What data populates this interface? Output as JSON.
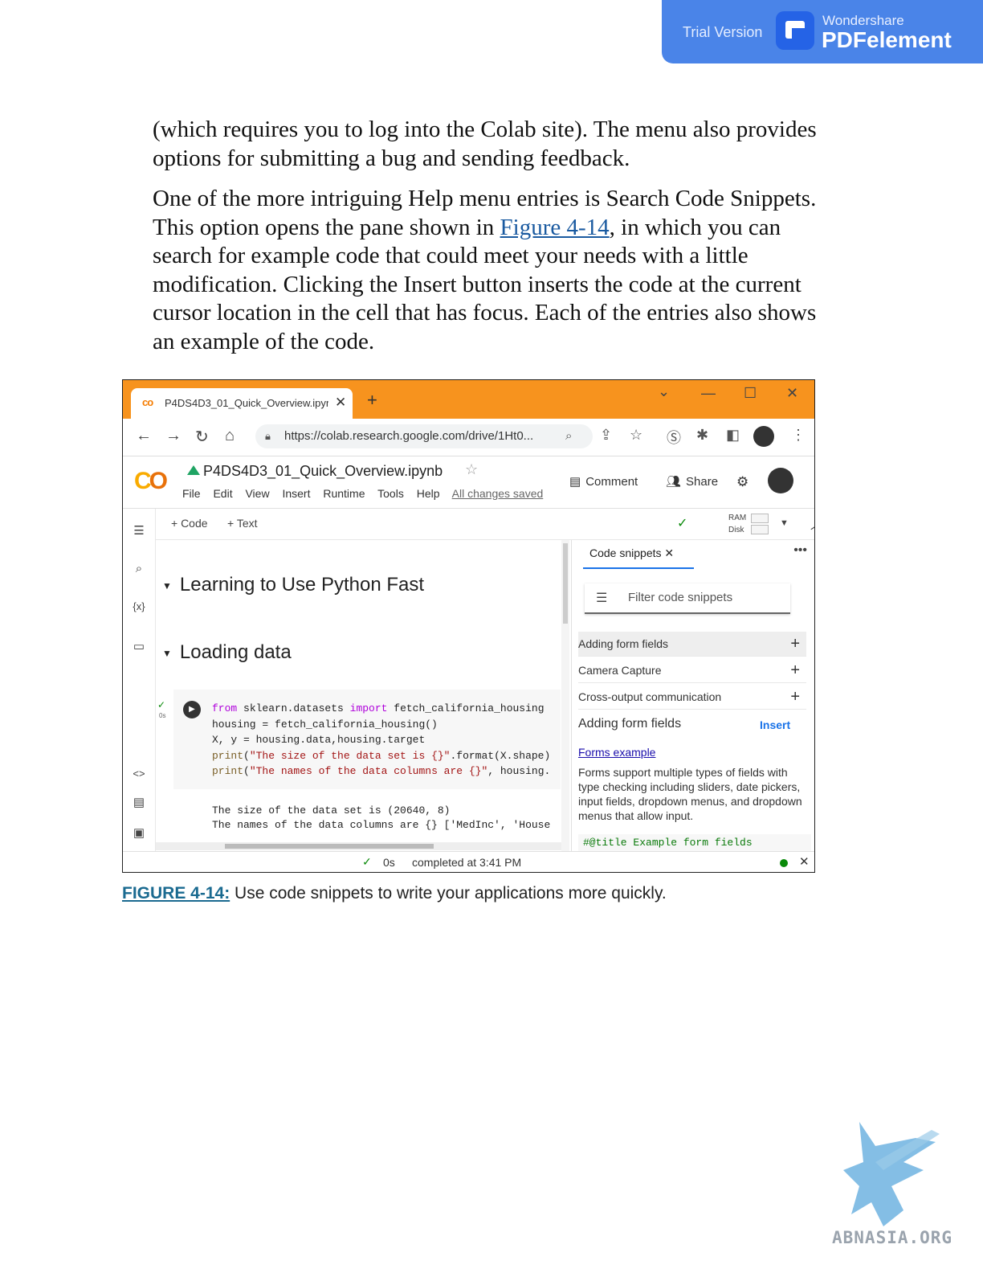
{
  "banner": {
    "trial_text": "Trial Version",
    "brand_top": "Wondershare",
    "brand_name": "PDFelement"
  },
  "body": {
    "para1": "(which requires you to log into the Colab site). The menu also provides options for submitting a bug and sending feedback.",
    "para2_before": "One of the more intriguing Help menu entries is Search Code Snippets. This option opens the pane shown in ",
    "para2_link": "Figure 4-14",
    "para2_after": ", in which you can search for example code that could meet your needs with a little modification. Clicking the Insert button inserts the code at the current cursor location in the cell that has focus. Each of the entries also shows an example of the code."
  },
  "figure": {
    "browser": {
      "tab_title": "P4DS4D3_01_Quick_Overview.ipynb",
      "tab_icon": "co",
      "url": "https://colab.research.google.com/drive/1Ht0...",
      "accent": "#f7931e"
    },
    "colab": {
      "logo": "CO",
      "notebook_title": "P4DS4D3_01_Quick_Overview.ipynb",
      "menus": [
        "File",
        "Edit",
        "View",
        "Insert",
        "Runtime",
        "Tools",
        "Help"
      ],
      "saved_status": "All changes saved",
      "comment_label": "Comment",
      "share_label": "Share",
      "add_code_label": "+ Code",
      "add_text_label": "+ Text",
      "ram_label": "RAM",
      "disk_label": "Disk"
    },
    "notebook": {
      "section1": "Learning to Use Python Fast",
      "section2": "Loading data",
      "exec_time": "0s",
      "output_line1": "The size of the data set is (20640, 8)",
      "output_line2": "The names of the data columns are {} ['MedInc', 'House"
    },
    "snippets": {
      "tab_label": "Code snippets",
      "filter_placeholder": "Filter code snippets",
      "items": [
        "Adding form fields",
        "Camera Capture",
        "Cross-output communication"
      ],
      "detail_title": "Adding form fields",
      "insert_label": "Insert",
      "detail_link": "Forms example",
      "detail_desc": "Forms support multiple types of fields with type checking including sliders, date pickers, input fields, dropdown menus, and dropdown menus that allow input.",
      "detail_code": "#@title Example form fields"
    },
    "status": {
      "secs": "0s",
      "text": "completed at 3:41 PM"
    }
  },
  "caption": {
    "label": "FIGURE 4-14:",
    "text": " Use code snippets to write your applications more quickly."
  },
  "watermark": {
    "text": "ABNASIA.ORG"
  }
}
